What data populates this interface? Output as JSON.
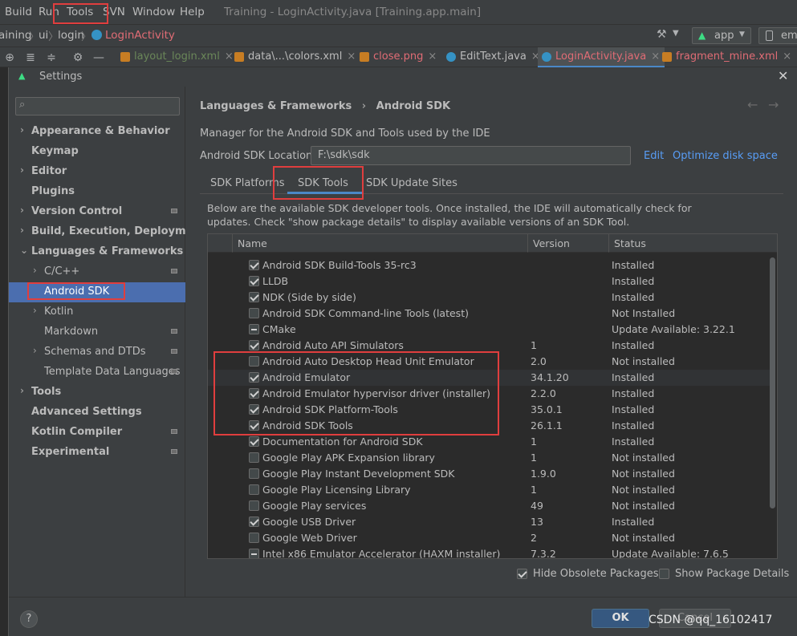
{
  "menubar": {
    "items": [
      "Build",
      "Run",
      "Tools",
      "SVN",
      "Window",
      "Help"
    ],
    "window_title": "Training - LoginActivity.java [Training.app.main]"
  },
  "navbar": {
    "crumbs": [
      "aining",
      "ui",
      "login",
      "LoginActivity"
    ],
    "run_config": "app",
    "device": "em"
  },
  "tabs": [
    {
      "label": "layout_login.xml",
      "color": "#6a8759",
      "icon_color": "#c77d23"
    },
    {
      "label": "data\\...\\colors.xml",
      "color": "#bbbbbb",
      "icon_color": "#c77d23"
    },
    {
      "label": "close.png",
      "color": "#e06c75",
      "icon_color": "#c77d23"
    },
    {
      "label": "EditText.java",
      "color": "#bbbbbb",
      "icon_color": "#3592c4"
    },
    {
      "label": "LoginActivity.java",
      "color": "#e06c75",
      "icon_color": "#3592c4"
    },
    {
      "label": "fragment_mine.xml",
      "color": "#e06c75",
      "icon_color": "#c77d23"
    }
  ],
  "dialog": {
    "title": "Settings",
    "close_symbol": "✕",
    "search_icon": "search-icon",
    "sidebar": [
      {
        "label": "Appearance & Behavior",
        "bold": true,
        "arrow": "›",
        "indent": 0
      },
      {
        "label": "Keymap",
        "bold": true,
        "arrow": "",
        "indent": 0
      },
      {
        "label": "Editor",
        "bold": true,
        "arrow": "›",
        "indent": 0
      },
      {
        "label": "Plugins",
        "bold": true,
        "arrow": "",
        "indent": 0
      },
      {
        "label": "Version Control",
        "bold": true,
        "arrow": "›",
        "indent": 0,
        "sq": true
      },
      {
        "label": "Build, Execution, Deployment",
        "bold": true,
        "arrow": "›",
        "indent": 0
      },
      {
        "label": "Languages & Frameworks",
        "bold": true,
        "arrow": "⌄",
        "indent": 0
      },
      {
        "label": "C/C++",
        "bold": false,
        "arrow": "›",
        "indent": 1,
        "sq": true
      },
      {
        "label": "Android SDK",
        "bold": false,
        "arrow": "",
        "indent": 1,
        "selected": true
      },
      {
        "label": "Kotlin",
        "bold": false,
        "arrow": "›",
        "indent": 1
      },
      {
        "label": "Markdown",
        "bold": false,
        "arrow": "",
        "indent": 1,
        "sq": true
      },
      {
        "label": "Schemas and DTDs",
        "bold": false,
        "arrow": "›",
        "indent": 1,
        "sq": true
      },
      {
        "label": "Template Data Languages",
        "bold": false,
        "arrow": "",
        "indent": 1,
        "sq": true
      },
      {
        "label": "Tools",
        "bold": true,
        "arrow": "›",
        "indent": 0
      },
      {
        "label": "Advanced Settings",
        "bold": true,
        "arrow": "",
        "indent": 0
      },
      {
        "label": "Kotlin Compiler",
        "bold": true,
        "arrow": "",
        "indent": 0,
        "sq": true
      },
      {
        "label": "Experimental",
        "bold": true,
        "arrow": "",
        "indent": 0,
        "sq": true
      }
    ],
    "breadcrumb": {
      "parent": "Languages & Frameworks",
      "sep": "›",
      "current": "Android SDK"
    },
    "description": "Manager for the Android SDK and Tools used by the IDE",
    "sdk_location_label": "Android SDK Location:",
    "sdk_location_value": "F:\\sdk\\sdk",
    "edit_link": "Edit",
    "optimize_link": "Optimize disk space",
    "subtabs": [
      "SDK Platforms",
      "SDK Tools",
      "SDK Update Sites"
    ],
    "info_text_1": "Below are the available SDK developer tools. Once installed, the IDE will automatically check for",
    "info_text_2": "updates. Check \"show package details\" to display available versions of an SDK Tool.",
    "table": {
      "headers": [
        "Name",
        "Version",
        "Status"
      ],
      "rows": [
        {
          "name": "Android SDK Build-Tools 35-rc3",
          "version": "",
          "status": "Installed",
          "state": "checked"
        },
        {
          "name": "LLDB",
          "version": "",
          "status": "Installed",
          "state": "checked"
        },
        {
          "name": "NDK (Side by side)",
          "version": "",
          "status": "Installed",
          "state": "checked"
        },
        {
          "name": "Android SDK Command-line Tools (latest)",
          "version": "",
          "status": "Not Installed",
          "state": "unchecked"
        },
        {
          "name": "CMake",
          "version": "",
          "status": "Update Available: 3.22.1",
          "state": "partial"
        },
        {
          "name": "Android Auto API Simulators",
          "version": "1",
          "status": "Installed",
          "state": "checked"
        },
        {
          "name": "Android Auto Desktop Head Unit Emulator",
          "version": "2.0",
          "status": "Not installed",
          "state": "unchecked"
        },
        {
          "name": "Android Emulator",
          "version": "34.1.20",
          "status": "Installed",
          "state": "checked"
        },
        {
          "name": "Android Emulator hypervisor driver (installer)",
          "version": "2.2.0",
          "status": "Installed",
          "state": "checked"
        },
        {
          "name": "Android SDK Platform-Tools",
          "version": "35.0.1",
          "status": "Installed",
          "state": "checked"
        },
        {
          "name": "Android SDK Tools",
          "version": "26.1.1",
          "status": "Installed",
          "state": "checked"
        },
        {
          "name": "Documentation for Android SDK",
          "version": "1",
          "status": "Installed",
          "state": "checked"
        },
        {
          "name": "Google Play APK Expansion library",
          "version": "1",
          "status": "Not installed",
          "state": "unchecked"
        },
        {
          "name": "Google Play Instant Development SDK",
          "version": "1.9.0",
          "status": "Not installed",
          "state": "unchecked"
        },
        {
          "name": "Google Play Licensing Library",
          "version": "1",
          "status": "Not installed",
          "state": "unchecked"
        },
        {
          "name": "Google Play services",
          "version": "49",
          "status": "Not installed",
          "state": "unchecked"
        },
        {
          "name": "Google USB Driver",
          "version": "13",
          "status": "Installed",
          "state": "checked"
        },
        {
          "name": "Google Web Driver",
          "version": "2",
          "status": "Not installed",
          "state": "unchecked"
        },
        {
          "name": "Intel x86 Emulator Accelerator (HAXM installer)",
          "version": "7.3.2",
          "status": "Update Available: 7.6.5",
          "state": "partial"
        }
      ]
    },
    "hide_obsolete_label": "Hide Obsolete Packages",
    "hide_obsolete_checked": true,
    "show_details_label": "Show Package Details",
    "show_details_checked": false,
    "help_symbol": "?",
    "ok_label": "OK",
    "cancel_label": "Cancel",
    "watermark": "CSDN @qq_16102417"
  },
  "colors": {
    "selection": "#4b6eaf",
    "accent_red": "#e03e3e",
    "link": "#589df6"
  }
}
